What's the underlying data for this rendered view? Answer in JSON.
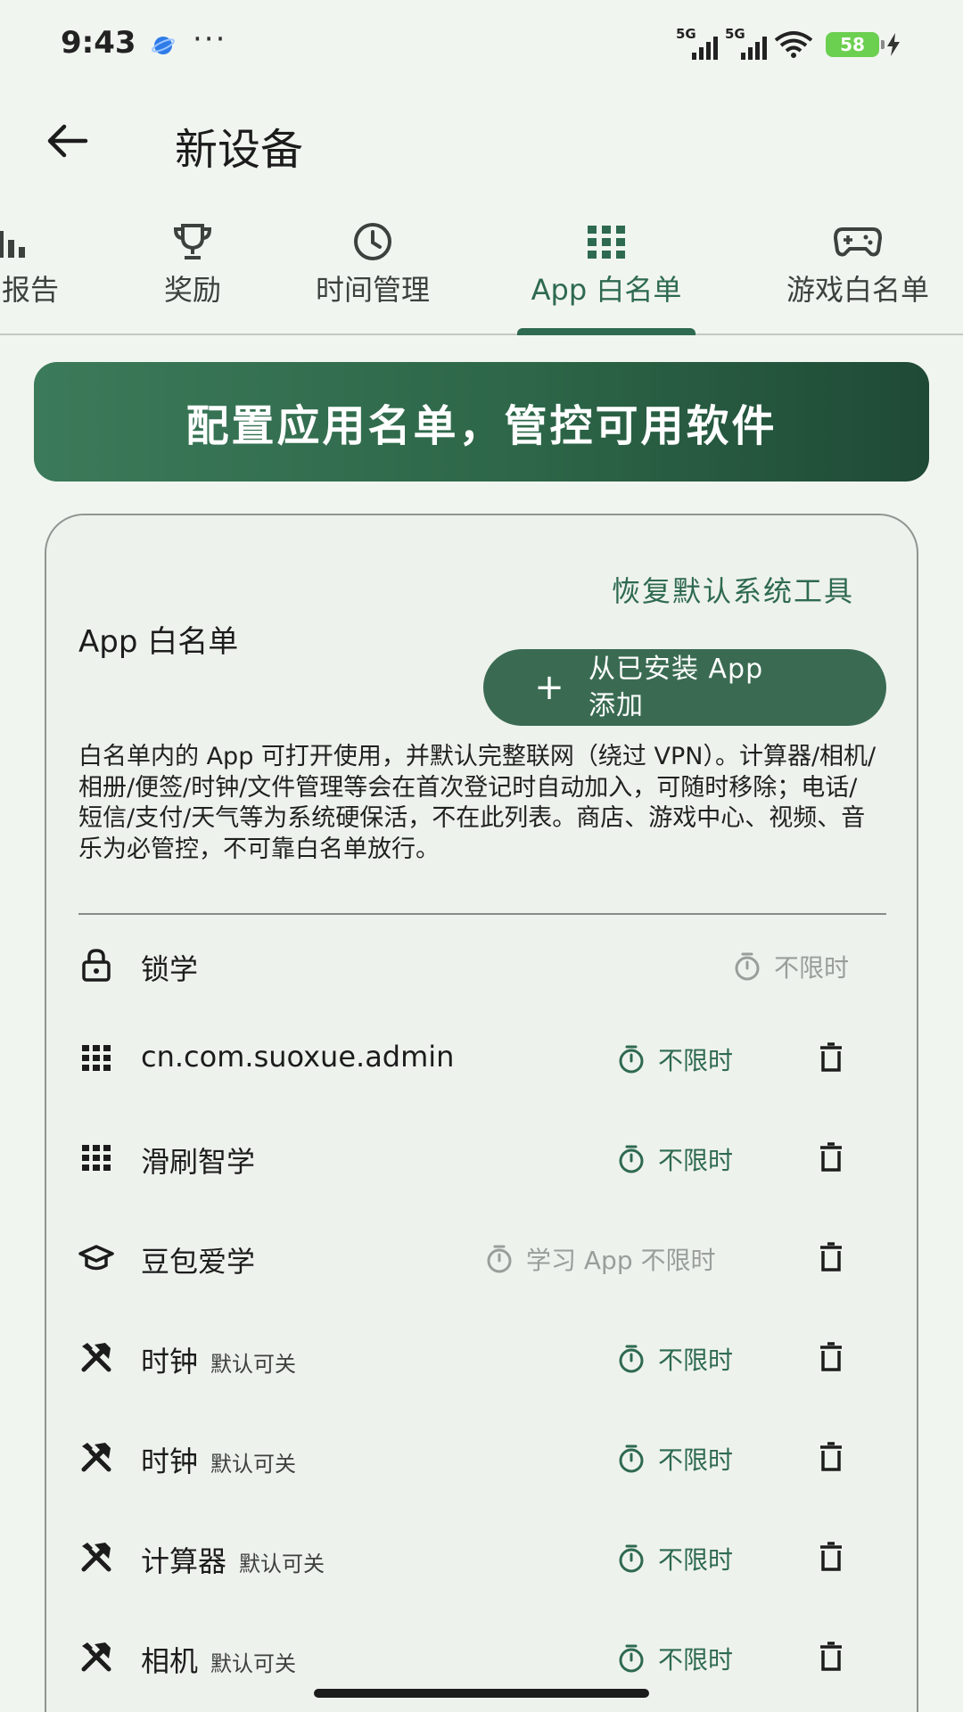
{
  "status_bar": {
    "time": "9:43",
    "dots": "···",
    "signal_1": "5G",
    "signal_2": "5G",
    "battery": "58",
    "planet_color": "#2f7be8"
  },
  "header": {
    "title": "新设备",
    "back_icon": "arrow-left-icon"
  },
  "tabs": [
    {
      "label": "月报告",
      "icon": "bar-chart-icon"
    },
    {
      "label": "奖励",
      "icon": "trophy-icon"
    },
    {
      "label": "时间管理",
      "icon": "clock-icon"
    },
    {
      "label": "App 白名单",
      "icon": "grid-icon",
      "active": true
    },
    {
      "label": "游戏白名单",
      "icon": "gamepad-icon"
    }
  ],
  "banner": {
    "text": "配置应用名单，管控可用软件"
  },
  "card": {
    "restore_label": "恢复默认系统工具",
    "title": "App 白名单",
    "add_button": {
      "label_line1": "从已安装 App",
      "label_line2": "添加",
      "icon": "plus-icon"
    },
    "description": "白名单内的 App 可打开使用，并默认完整联网（绕过 VPN）。计算器/相机/相册/便签/时钟/文件管理等会在首次登记时自动加入，可随时移除；电话/短信/支付/天气等为系统硬保活，不在此列表。商店、游戏中心、视频、音乐为必管控，不可靠白名单放行。",
    "apps": [
      {
        "name": "锁学",
        "tag": "",
        "limit": "不限时",
        "icon": "lock-icon",
        "limit_style": "gray",
        "deletable": false
      },
      {
        "name": "cn.com.suoxue.admin",
        "tag": "",
        "limit": "不限时",
        "icon": "grid-icon",
        "limit_style": "green",
        "deletable": true
      },
      {
        "name": "滑刷智学",
        "tag": "",
        "limit": "不限时",
        "icon": "grid-icon",
        "limit_style": "green",
        "deletable": true
      },
      {
        "name": "豆包爱学",
        "tag": "",
        "limit": "学习 App 不限时",
        "icon": "graduation-cap-icon",
        "limit_style": "gray",
        "deletable": true
      },
      {
        "name": "时钟",
        "tag": "默认可关",
        "limit": "不限时",
        "icon": "tools-icon",
        "limit_style": "green",
        "deletable": true
      },
      {
        "name": "时钟",
        "tag": "默认可关",
        "limit": "不限时",
        "icon": "tools-icon",
        "limit_style": "green",
        "deletable": true
      },
      {
        "name": "计算器",
        "tag": "默认可关",
        "limit": "不限时",
        "icon": "tools-icon",
        "limit_style": "green",
        "deletable": true
      },
      {
        "name": "相机",
        "tag": "默认可关",
        "limit": "不限时",
        "icon": "tools-icon",
        "limit_style": "green",
        "deletable": true
      }
    ]
  },
  "colors": {
    "accent": "#2e6a4f",
    "background": "#f1f5f0",
    "muted": "#9a9e9a"
  }
}
